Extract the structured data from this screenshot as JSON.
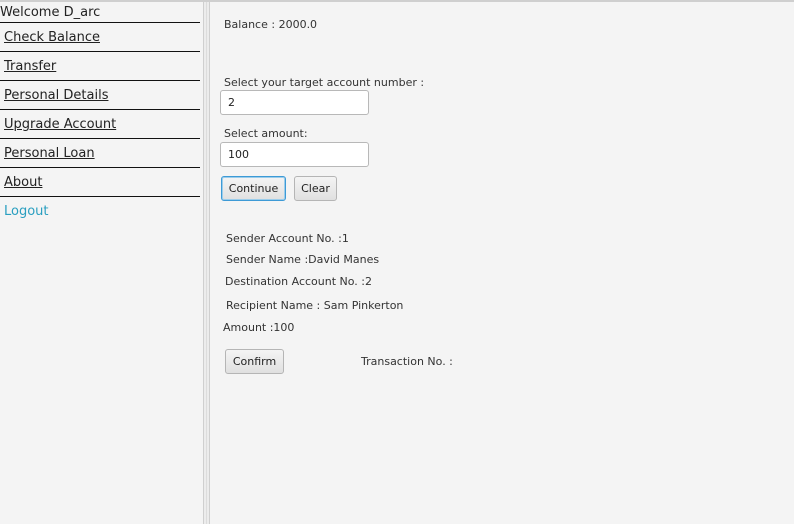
{
  "sidebar": {
    "welcome": "Welcome D_arc",
    "items": [
      {
        "label": "Check Balance"
      },
      {
        "label": "Transfer"
      },
      {
        "label": "Personal Details"
      },
      {
        "label": "Upgrade Account"
      },
      {
        "label": "Personal Loan"
      },
      {
        "label": "About"
      }
    ],
    "logout": "Logout",
    "logout_color": "#2a9fc0"
  },
  "main": {
    "balance": "Balance : 2000.0",
    "target_label": "Select your target account number :",
    "target_value": "2",
    "amount_label": "Select amount:",
    "amount_value": "100",
    "continue_label": "Continue",
    "clear_label": "Clear",
    "summary": {
      "sender_account": "Sender Account No. :1",
      "sender_name": "Sender Name :David Manes",
      "destination_account": "Destination Account No. :2",
      "recipient_name": "Recipient Name : Sam Pinkerton",
      "amount": "Amount :100"
    },
    "confirm_label": "Confirm",
    "transaction_no": "Transaction No. :"
  }
}
